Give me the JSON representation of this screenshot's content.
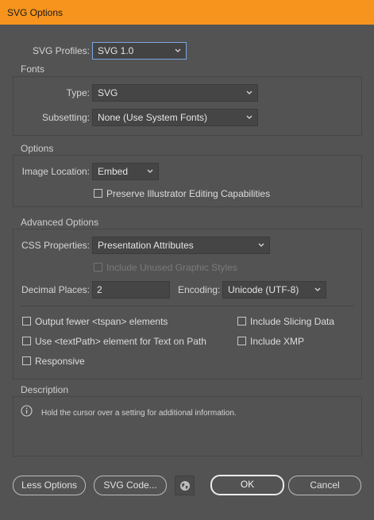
{
  "window": {
    "title": "SVG Options"
  },
  "profiles": {
    "label": "SVG Profiles:",
    "value": "SVG 1.0"
  },
  "fonts": {
    "title": "Fonts",
    "type_label": "Type:",
    "type_value": "SVG",
    "subsetting_label": "Subsetting:",
    "subsetting_value": "None (Use System Fonts)"
  },
  "options": {
    "title": "Options",
    "image_location_label": "Image Location:",
    "image_location_value": "Embed",
    "preserve_label": "Preserve Illustrator Editing Capabilities",
    "preserve_checked": false
  },
  "advanced": {
    "title": "Advanced Options",
    "css_label": "CSS Properties:",
    "css_value": "Presentation Attributes",
    "include_unused_label": "Include Unused Graphic Styles",
    "decimal_label": "Decimal Places:",
    "decimal_value": "2",
    "encoding_label": "Encoding:",
    "encoding_value": "Unicode (UTF-8)",
    "checkboxes": {
      "fewer_tspan": "Output fewer <tspan> elements",
      "textpath": "Use <textPath> element for Text on Path",
      "responsive": "Responsive",
      "slicing": "Include Slicing Data",
      "xmp": "Include XMP"
    }
  },
  "description": {
    "title": "Description",
    "text": "Hold the cursor over a setting for additional information."
  },
  "buttons": {
    "less_options": "Less Options",
    "svg_code": "SVG Code...",
    "ok": "OK",
    "cancel": "Cancel"
  },
  "colors": {
    "titlebar": "#f7941d",
    "background": "#535353",
    "focus_border": "#7aa6e0"
  }
}
